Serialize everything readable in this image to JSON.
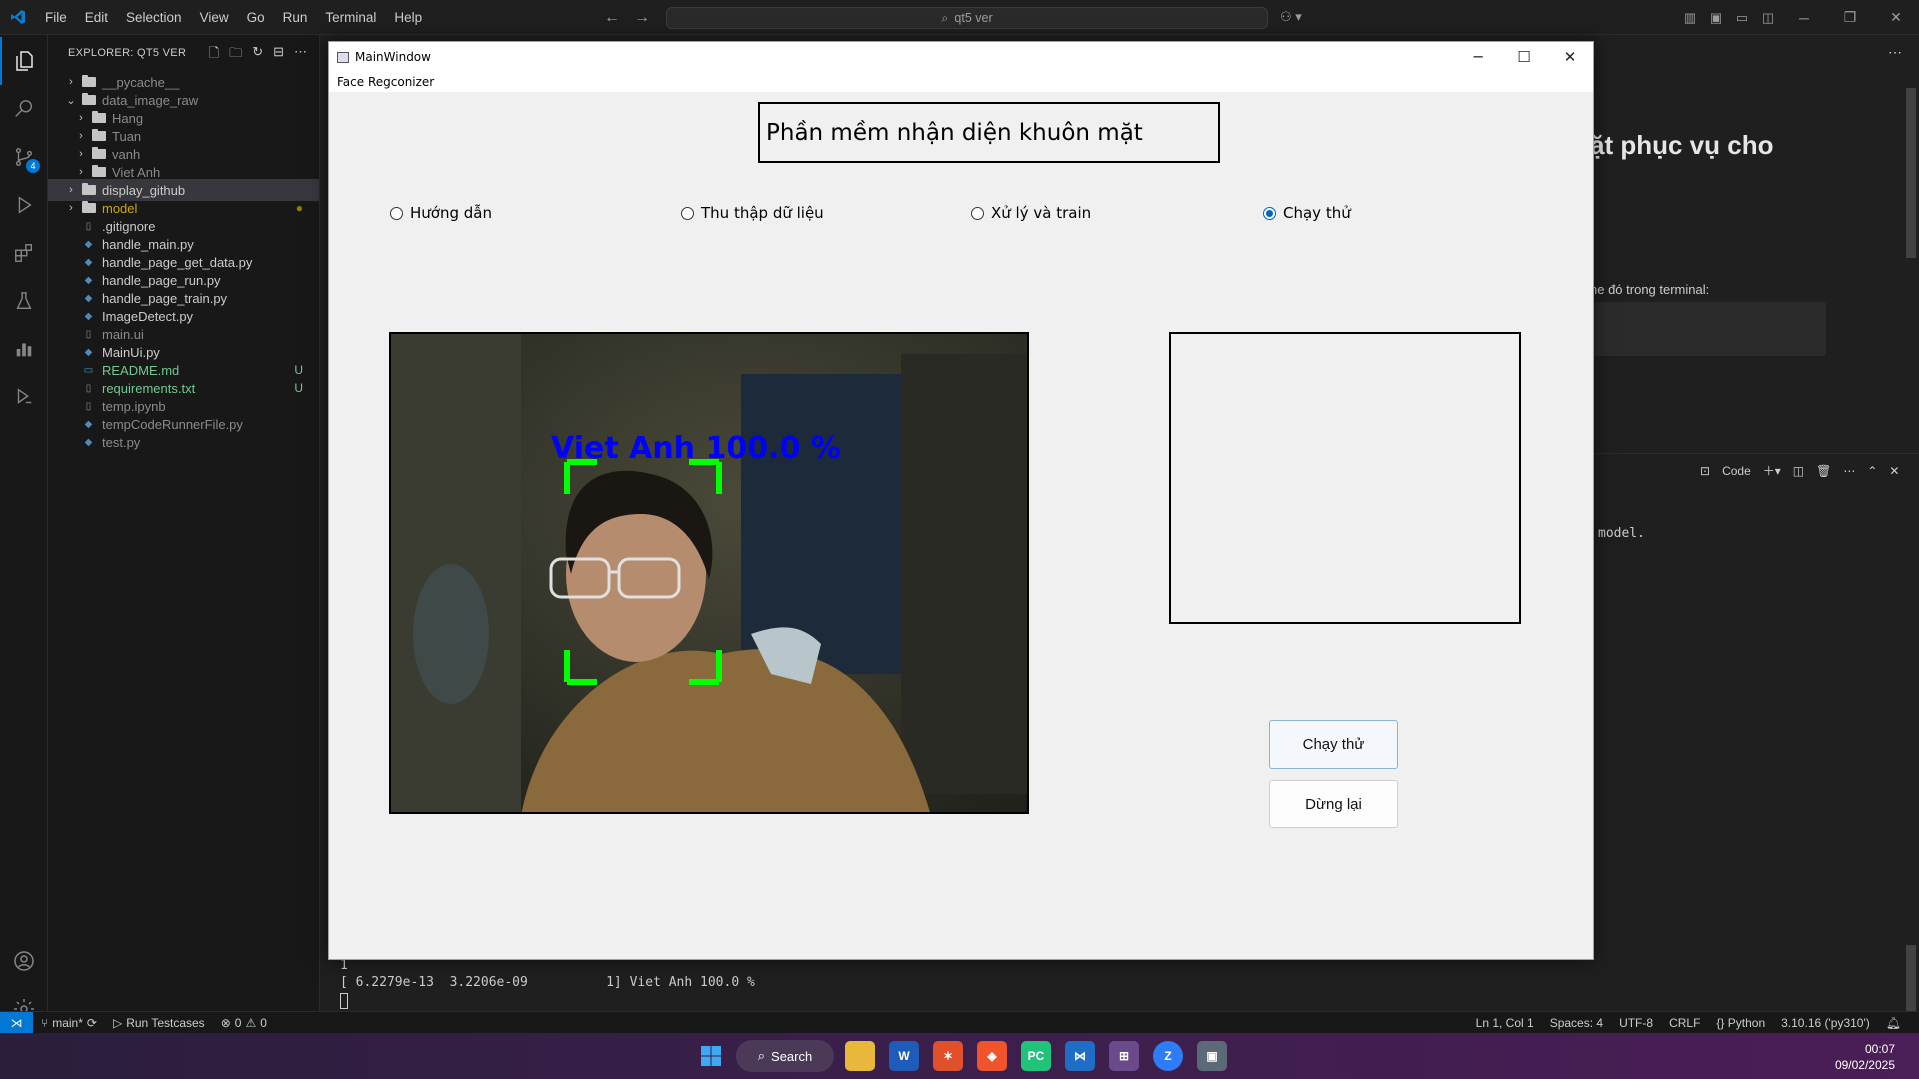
{
  "vscode": {
    "menu": [
      "File",
      "Edit",
      "Selection",
      "View",
      "Go",
      "Run",
      "Terminal",
      "Help"
    ],
    "command_center": "qt5 ver",
    "explorer_title": "EXPLORER: QT5 VER",
    "source_control_badge": "4",
    "tree": [
      {
        "label": "__pycache__",
        "type": "folder",
        "expanded": false,
        "indent": 0,
        "style": "dim"
      },
      {
        "label": "data_image_raw",
        "type": "folder",
        "expanded": true,
        "indent": 0,
        "style": "dim"
      },
      {
        "label": "Hang",
        "type": "folder",
        "expanded": false,
        "indent": 1,
        "style": "dim"
      },
      {
        "label": "Tuan",
        "type": "folder",
        "expanded": false,
        "indent": 1,
        "style": "dim"
      },
      {
        "label": "vanh",
        "type": "folder",
        "expanded": false,
        "indent": 1,
        "style": "dim"
      },
      {
        "label": "Viet Anh",
        "type": "folder",
        "expanded": false,
        "indent": 1,
        "style": "dim"
      },
      {
        "label": "display_github",
        "type": "folder",
        "expanded": false,
        "indent": 0,
        "style": "normal",
        "selected": true
      },
      {
        "label": "model",
        "type": "folder",
        "expanded": false,
        "indent": 0,
        "style": "yellow",
        "deco": "●"
      },
      {
        "label": ".gitignore",
        "type": "file",
        "indent": 0,
        "style": "normal"
      },
      {
        "label": "handle_main.py",
        "type": "py",
        "indent": 0,
        "style": "normal"
      },
      {
        "label": "handle_page_get_data.py",
        "type": "py",
        "indent": 0,
        "style": "normal"
      },
      {
        "label": "handle_page_run.py",
        "type": "py",
        "indent": 0,
        "style": "normal"
      },
      {
        "label": "handle_page_train.py",
        "type": "py",
        "indent": 0,
        "style": "normal"
      },
      {
        "label": "ImageDetect.py",
        "type": "py",
        "indent": 0,
        "style": "normal"
      },
      {
        "label": "main.ui",
        "type": "file",
        "indent": 0,
        "style": "dim"
      },
      {
        "label": "MainUi.py",
        "type": "py",
        "indent": 0,
        "style": "normal"
      },
      {
        "label": "README.md",
        "type": "md",
        "indent": 0,
        "style": "green",
        "deco": "U"
      },
      {
        "label": "requirements.txt",
        "type": "file",
        "indent": 0,
        "style": "green",
        "deco": "U"
      },
      {
        "label": "temp.ipynb",
        "type": "file",
        "indent": 0,
        "style": "dim"
      },
      {
        "label": "tempCodeRunnerFile.py",
        "type": "py",
        "indent": 0,
        "style": "dim"
      },
      {
        "label": "test.py",
        "type": "py",
        "indent": 0,
        "style": "dim"
      }
    ],
    "editor_heading_fragment": "ặt phục vụ cho",
    "editor_text_fragment": "ne đó trong terminal:",
    "terminal_right_fragment": "model.",
    "panel_tool_label": "Code",
    "terminal_lines": [
      "1",
      "[ 6.2279e-13  3.2206e-09          1] Viet Anh 100.0 %"
    ],
    "status_left": {
      "branch": "main*",
      "run_tests": "Run Testcases",
      "errors": "0",
      "warnings": "0"
    },
    "status_right": [
      "Ln 1, Col 1",
      "Spaces: 4",
      "UTF-8",
      "CRLF",
      "{} Python",
      "3.10.16 ('py310')"
    ],
    "accent": "#0078d4"
  },
  "taskbar": {
    "search_label": "Search",
    "time": "00:07",
    "date": "09/02/2025"
  },
  "qt": {
    "window_title": "MainWindow",
    "menu_label": "Face Regconizer",
    "app_title": "Phần mềm nhận diện khuôn mặt",
    "radios": [
      {
        "label": "Hướng dẫn",
        "checked": false
      },
      {
        "label": "Thu thập dữ liệu",
        "checked": false
      },
      {
        "label": "Xử lý và train",
        "checked": false
      },
      {
        "label": "Chạy thử",
        "checked": true
      }
    ],
    "detection_label": "Viet Anh 100.0 %",
    "detection_color": "#0000ff",
    "box_color": "#00ff00",
    "run_button": "Chạy thử",
    "stop_button": "Dừng lại"
  }
}
